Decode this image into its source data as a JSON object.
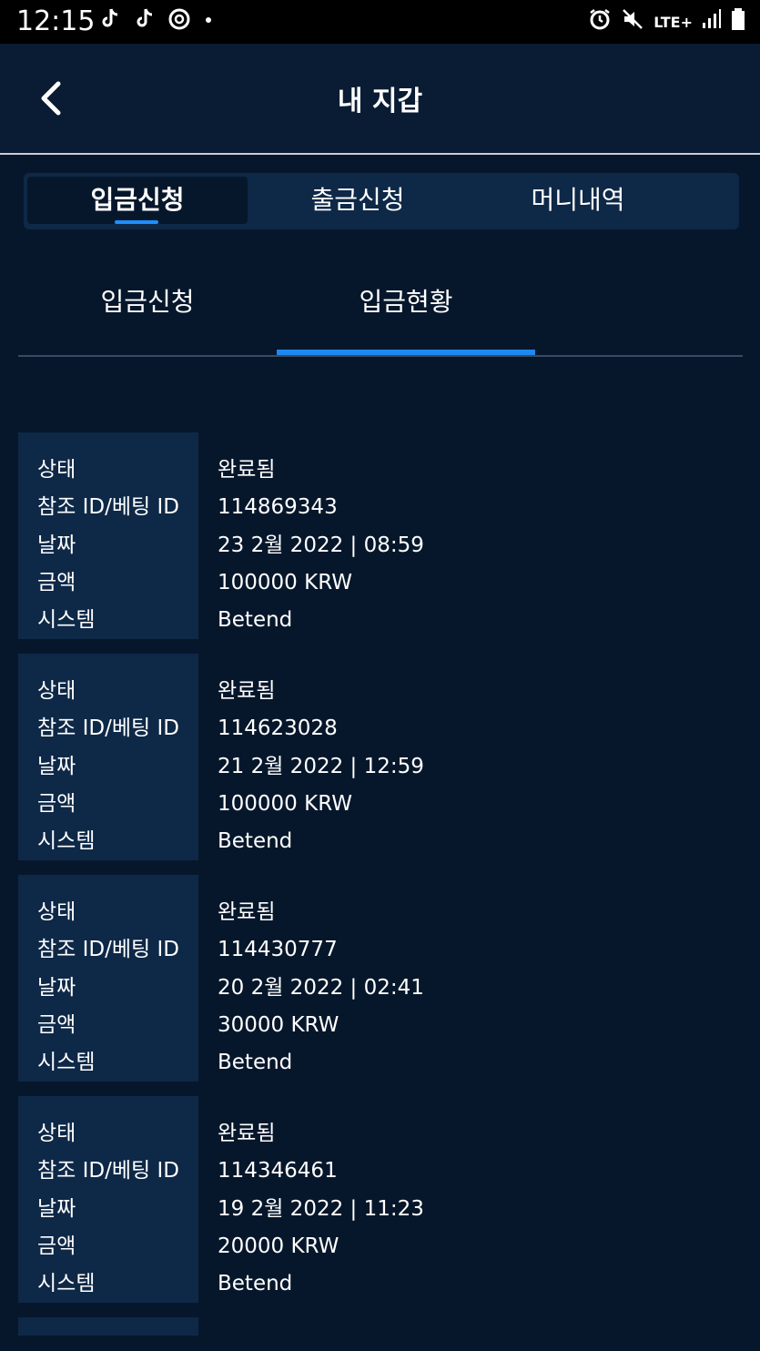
{
  "status_bar": {
    "time": "12:15",
    "left_icons": [
      "tiktok-icon",
      "tiktok-icon",
      "sync-icon",
      "dot-icon"
    ],
    "network": "LTE+",
    "right_icons": [
      "alarm-icon",
      "mute-icon",
      "lte-icon",
      "signal-icon",
      "battery-icon"
    ]
  },
  "header": {
    "title": "내 지갑",
    "back_icon": "chevron-left-icon"
  },
  "tabs": [
    {
      "label": "입금신청",
      "active": true
    },
    {
      "label": "출금신청",
      "active": false
    },
    {
      "label": "머니내역",
      "active": false
    }
  ],
  "subtabs": [
    {
      "label": "입금신청",
      "active": false
    },
    {
      "label": "입금현황",
      "active": true
    }
  ],
  "labels": {
    "status": "상태",
    "ref_id": "참조 ID/베팅 ID",
    "date": "날짜",
    "amount": "금액",
    "system": "시스템"
  },
  "records": [
    {
      "status": "완료됨",
      "ref_id": "114869343",
      "date": "23 2월 2022 | 08:59",
      "amount": "100000 KRW",
      "system": "Betend"
    },
    {
      "status": "완료됨",
      "ref_id": "114623028",
      "date": "21 2월 2022 | 12:59",
      "amount": "100000 KRW",
      "system": "Betend"
    },
    {
      "status": "완료됨",
      "ref_id": "114430777",
      "date": "20 2월 2022 | 02:41",
      "amount": "30000 KRW",
      "system": "Betend"
    },
    {
      "status": "완료됨",
      "ref_id": "114346461",
      "date": "19 2월 2022 | 11:23",
      "amount": "20000 KRW",
      "system": "Betend"
    }
  ],
  "colors": {
    "background": "#07172b",
    "panel": "#0e2847",
    "accent": "#1e88f0",
    "text": "#ffffff"
  }
}
